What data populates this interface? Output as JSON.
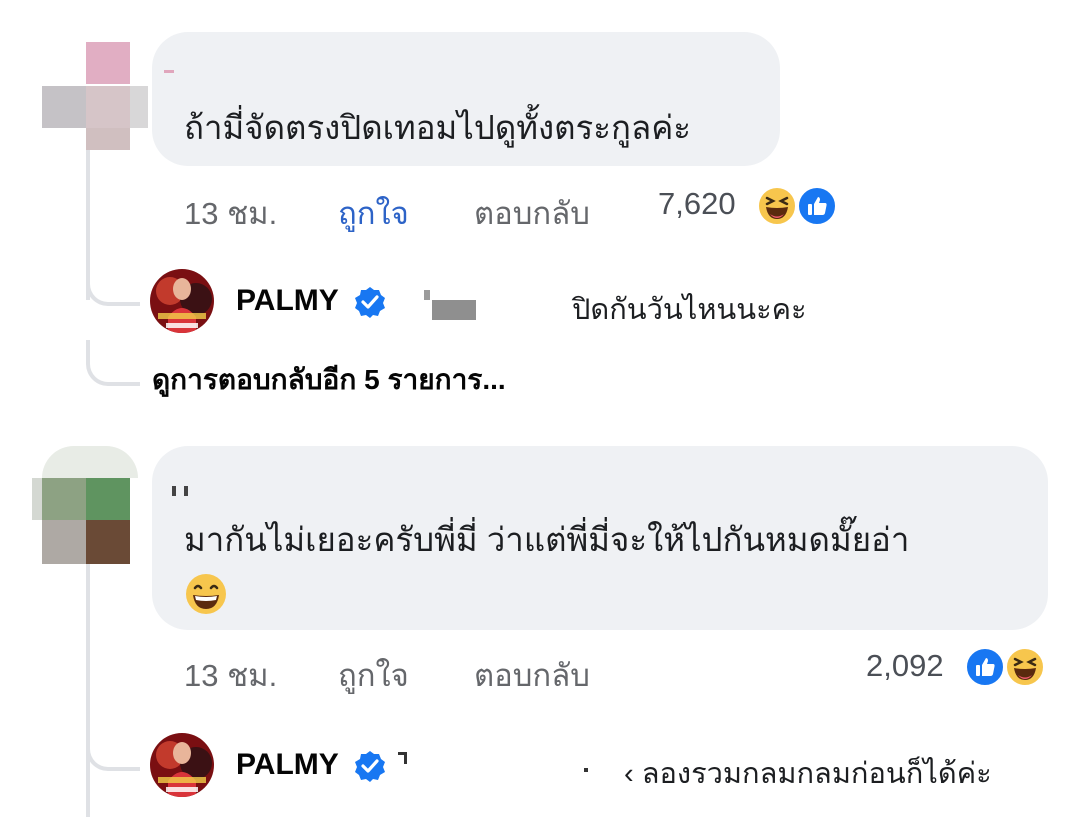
{
  "comment1": {
    "text": "ถ้ามี่จัดตรงปิดเทอมไปดูทั้งตระกูลค่ะ",
    "time": "13 ชม.",
    "like_label": "ถูกใจ",
    "reply_label": "ตอบกลับ",
    "reaction_count": "7,620",
    "reactions": [
      "haha-icon",
      "like-icon"
    ],
    "reply": {
      "author": "PALMY",
      "verified": true,
      "text": "ปิดกันวันไหนนะคะ"
    },
    "more_replies": "ดูการตอบกลับอีก 5 รายการ..."
  },
  "comment2": {
    "text_line1": "มากันไม่เยอะครับพี่มี่ ว่าแต่พี่มี่จะให้ไปกันหมดมั๊ยอ่า",
    "time": "13 ชม.",
    "like_label": "ถูกใจ",
    "reply_label": "ตอบกลับ",
    "reaction_count": "2,092",
    "reactions": [
      "like-icon",
      "haha-icon"
    ],
    "reply": {
      "author": "PALMY",
      "verified": true,
      "text": "ลองรวมกลมกลมก่อนก็ได้ค่ะ"
    }
  },
  "colors": {
    "like_active": "#2d63c7",
    "bubble": "#eff1f4",
    "verified": "#1877f2",
    "haha": "#f7c64d"
  }
}
